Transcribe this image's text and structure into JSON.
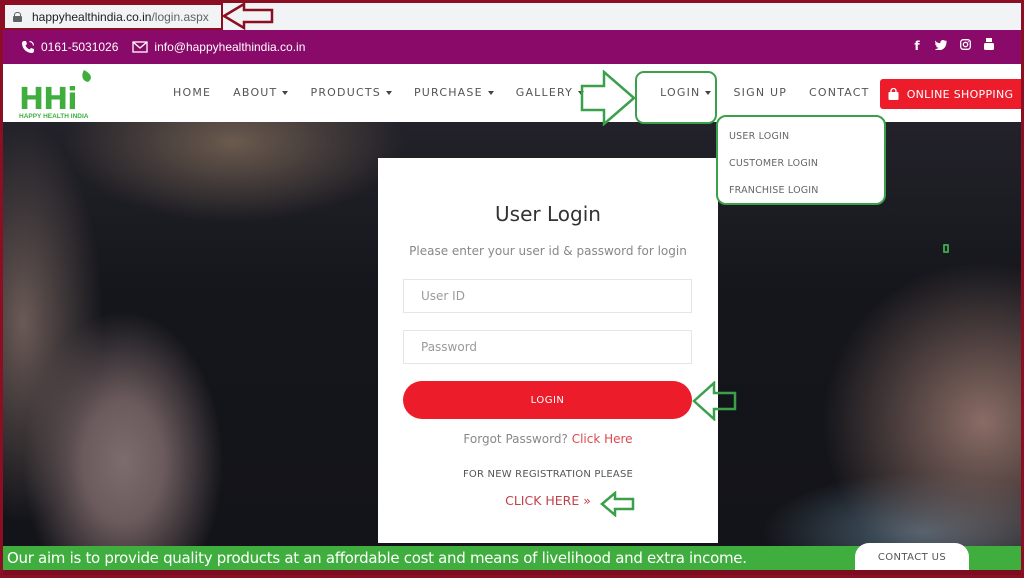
{
  "browser": {
    "url_host": "happyhealthindia.co.in",
    "url_path": "/login.aspx"
  },
  "topbar": {
    "phone": "0161-5031026",
    "email": "info@happyhealthindia.co.in",
    "social": [
      {
        "icon": "facebook-icon",
        "glyph": "f"
      },
      {
        "icon": "twitter-icon",
        "glyph": "🐦"
      },
      {
        "icon": "instagram-icon",
        "glyph": "◎"
      },
      {
        "icon": "youtube-icon",
        "glyph": "▣"
      }
    ]
  },
  "logo": {
    "mark": "HHi",
    "tagline": "HAPPY HEALTH INDIA"
  },
  "nav": {
    "items": [
      {
        "label": "HOME",
        "dropdown": false
      },
      {
        "label": "ABOUT",
        "dropdown": true
      },
      {
        "label": "PRODUCTS",
        "dropdown": true
      },
      {
        "label": "PURCHASE",
        "dropdown": true
      },
      {
        "label": "GALLERY",
        "dropdown": true
      },
      {
        "label": "LOGIN",
        "dropdown": true
      },
      {
        "label": "SIGN UP",
        "dropdown": false
      },
      {
        "label": "CONTACT",
        "dropdown": false
      }
    ],
    "shop_button": "ONLINE SHOPPING"
  },
  "login_dropdown": {
    "items": [
      "USER LOGIN",
      "CUSTOMER LOGIN",
      "FRANCHISE LOGIN"
    ]
  },
  "login_card": {
    "title": "User Login",
    "subtitle": "Please enter your user id & password for login",
    "userid_placeholder": "User ID",
    "userid_value": "",
    "password_placeholder": "Password",
    "password_value": "",
    "login_button": "LOGIN",
    "forgot_text": "Forgot Password?",
    "forgot_link": "Click Here",
    "new_registration": "FOR NEW REGISTRATION PLEASE",
    "register_link": "CLICK HERE »"
  },
  "bottombar": {
    "aim": "Our aim is to provide quality products at an affordable cost and means of livelihood and extra income.",
    "contact_button": "CONTACT US"
  },
  "colors": {
    "topbar": "#8a0a6a",
    "brand_green": "#3fae3f",
    "accent_red": "#ec1c2b",
    "annotation_green": "#3aa04a",
    "annotation_maroon": "#8b0e22"
  }
}
